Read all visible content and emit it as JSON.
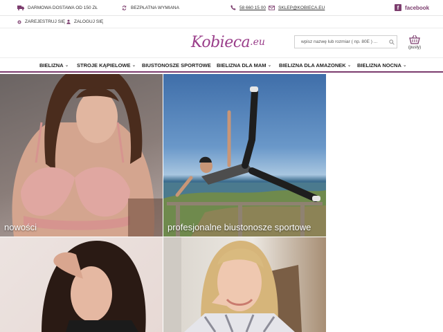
{
  "topbar": {
    "delivery": "DARMOWA DOSTAWA OD 150 ZŁ",
    "exchange": "BEZPŁATNA WYMIANA",
    "phone": "58 660 15 00",
    "email": "SKLEP@KOBIECA.EU",
    "facebook": "facebook"
  },
  "account": {
    "register": "ZAREJESTRUJ SIĘ",
    "login": "ZALOGUJ SIĘ"
  },
  "header": {
    "logo_main": "Kobieca",
    "logo_suffix": ".eu",
    "search_placeholder": "wpisz nazwę lub rozmiar ( np. 80E ) ...",
    "cart_label": "(pusty)"
  },
  "nav": {
    "items": [
      {
        "label": "BIELIZNA",
        "dropdown": true
      },
      {
        "label": "STROJE KĄPIELOWE",
        "dropdown": true
      },
      {
        "label": "BIUSTONOSZE SPORTOWE",
        "dropdown": false
      },
      {
        "label": "BIELIZNA DLA MAM",
        "dropdown": true
      },
      {
        "label": "BIELIZNA DLA AMAZONEK",
        "dropdown": true
      },
      {
        "label": "BIELIZNA NOCNA",
        "dropdown": true
      }
    ]
  },
  "tiles": [
    {
      "caption": "nowości"
    },
    {
      "caption": "profesjonalne biustonosze sportowe"
    },
    {
      "caption": ""
    },
    {
      "caption": ""
    }
  ],
  "colors": {
    "brand": "#7c3d6e",
    "nav_border": "#7a3a6d"
  }
}
